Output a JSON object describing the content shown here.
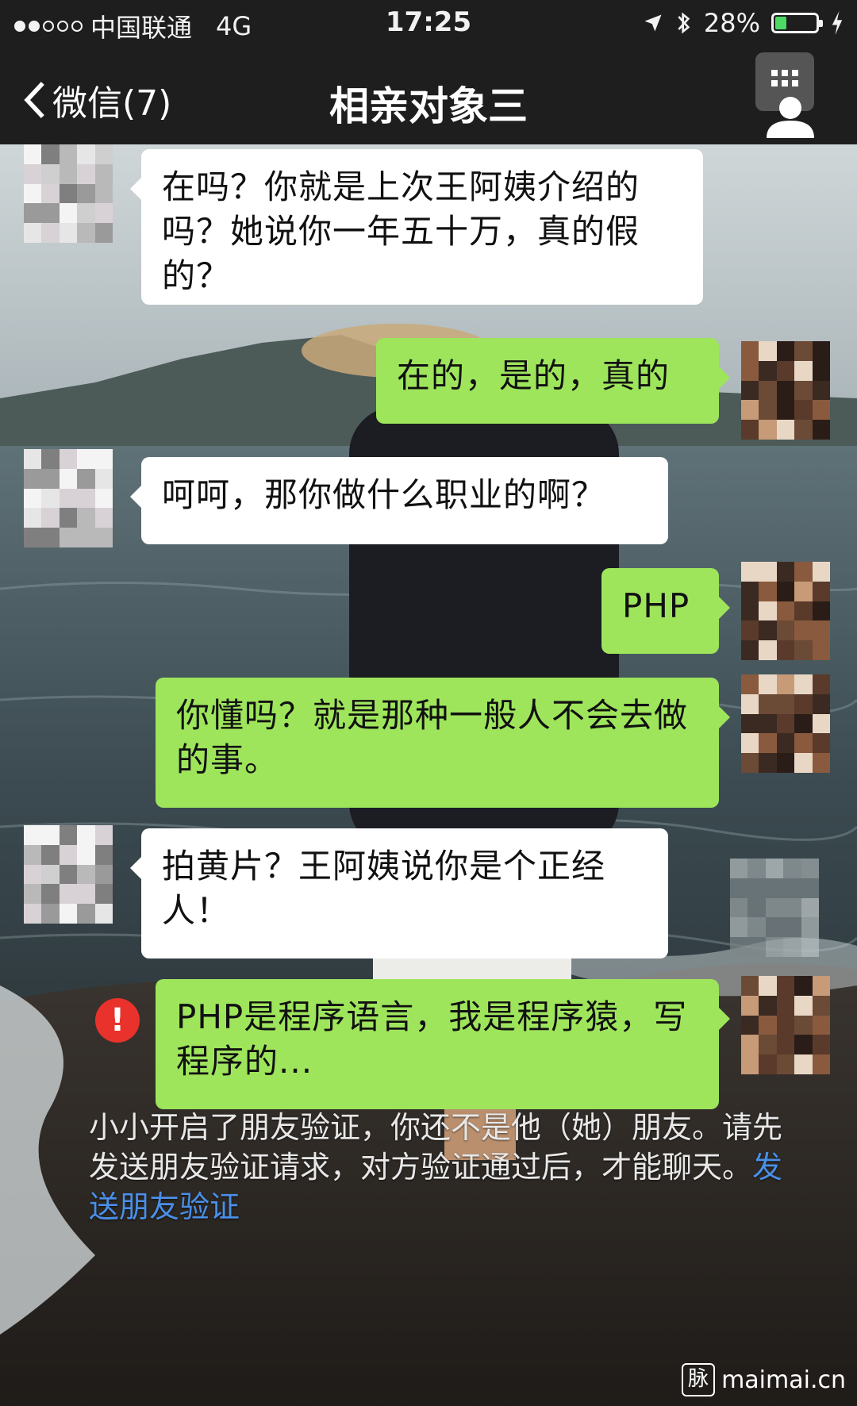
{
  "status_bar": {
    "signal_dots_filled": 2,
    "signal_dots_total": 5,
    "carrier": "中国联通",
    "network": "4G",
    "time": "17:25",
    "battery_percent_text": "28%",
    "battery_level": 0.28,
    "icons": [
      "location-arrow-icon",
      "bluetooth-icon",
      "charging-bolt-icon"
    ]
  },
  "nav": {
    "back_label": "微信(7)",
    "title": "相亲对象三",
    "profile_icon": "contact-profile-icon"
  },
  "messages": [
    {
      "side": "in",
      "text": "在吗？你就是上次王阿姨介绍的吗？她说你一年五十万，真的假的？"
    },
    {
      "side": "out",
      "text": "在的，是的，真的"
    },
    {
      "side": "in",
      "text": "呵呵，那你做什么职业的啊？"
    },
    {
      "side": "out",
      "text": "PHP"
    },
    {
      "side": "out",
      "text": "你懂吗？就是那种一般人不会去做的事。"
    },
    {
      "side": "in",
      "text": "拍黄片？王阿姨说你是个正经人！"
    },
    {
      "side": "out",
      "text": "PHP是程序语言，我是程序猿，写程序的..."
    }
  ],
  "failed_icon": "!",
  "system_note": {
    "text": "小小开启了朋友验证，你还不是他（她）朋友。请先发送朋友验证请求，对方验证通过后，才能聊天。",
    "link": "发送朋友验证"
  },
  "watermark": {
    "logo": "脉",
    "text": "maimai.cn"
  },
  "colors": {
    "outgoing_bubble": "#9ee55c",
    "incoming_bubble": "#ffffff",
    "header_bg": "#1e1e1e",
    "error_red": "#e8322b",
    "link_blue": "#4a8fe8"
  }
}
